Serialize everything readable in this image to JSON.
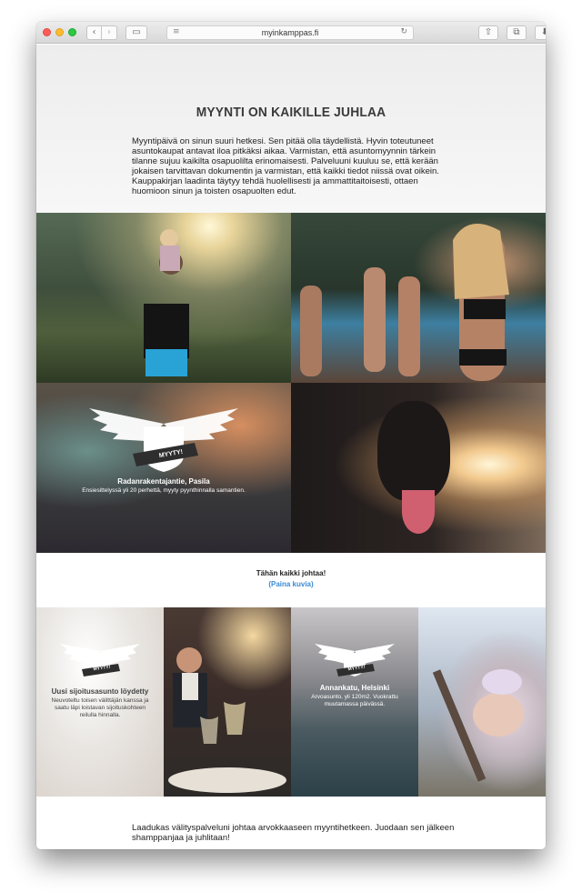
{
  "browser": {
    "url": "myinkamppas.fi",
    "back_icon": "‹",
    "forward_icon": "›",
    "sidebar_icon": "▭",
    "reader_icon": "≡",
    "reload_icon": "↻",
    "share_icon": "⇧",
    "tabs_icon": "⧉",
    "download_icon": "⬇",
    "new_tab_icon": "+"
  },
  "hero": {
    "title": "MYYNTI ON KAIKILLE JUHLAA",
    "text": "Myyntipäivä on sinun suuri hetkesi. Sen pitää olla täydellistä. Hyvin toteutuneet asuntokaupat antavat iloa pitkäksi aikaa. Varmistan, että asuntomyynnin tärkein tilanne sujuu kaikilta osapuolilta erinomaisesti. Palveluuni kuuluu se, että kerään jokaisen tarvittavan dokumentin ja varmistan, että kaikki tiedot niissä ovat oikein. Kauppakirjan laadinta täytyy tehdä huolellisesti ja ammattitaitoisesti, ottaen huomioon sinun ja toisten osapuolten edut."
  },
  "grid": {
    "tile3": {
      "badge": "MYYTY!",
      "title": "Radanrakentajantie, Pasila",
      "text": "Ensiesittelyssä yli 20 perhettä, myyty pyynthinnalla samantien."
    }
  },
  "middle": {
    "line1": "Tähän kaikki johtaa!",
    "line2": "(Paina kuvia)"
  },
  "bottom": {
    "tile1": {
      "badge": "MYYTY!",
      "title": "Uusi sijoitusasunto löydetty",
      "text": "Neuvoteltu toisen välittäjän kanssa ja saatu läpi loistavan sijoituskohteen reilulla hinnalla."
    },
    "tile3": {
      "badge": "MYYTY!",
      "title": "Annankatu, Helsinki",
      "text": "Arvoasunto, yli 120m2. Vuokrattu muutamassa päivässä."
    }
  },
  "footer": {
    "text": "Laadukas välityspalveluni johtaa arvokkaaseen myyntihetkeen. Juodaan sen jälkeen shamppanjaa ja juhlitaan!"
  }
}
